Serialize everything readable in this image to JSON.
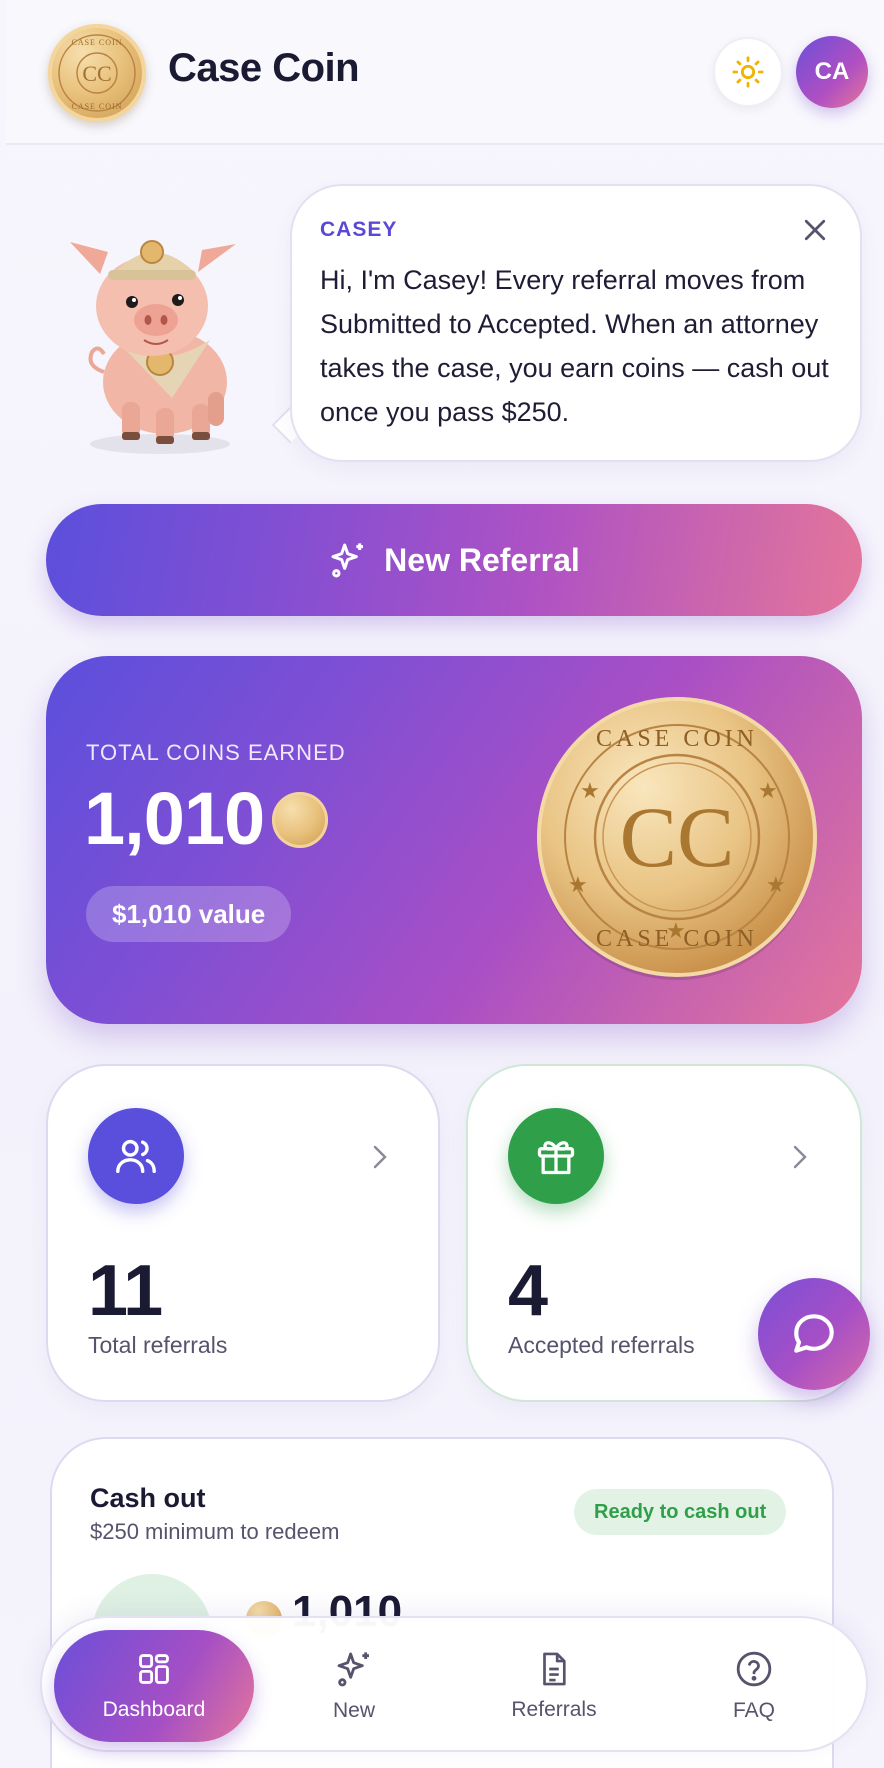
{
  "header": {
    "app_title": "Case Coin",
    "theme_icon": "sun-icon",
    "avatar_initials": "CA",
    "logo_text_top": "CASE COIN",
    "logo_text_bottom": "CASE COIN",
    "logo_monogram": "CC"
  },
  "mascot": {
    "name": "CASEY",
    "message": "Hi, I'm Casey! Every referral moves from Submitted to Accepted. When an attorney takes the case, you earn coins — cash out once you pass $250.",
    "close_icon": "close-icon"
  },
  "new_referral": {
    "label": "New Referral",
    "icon": "sparkles-icon"
  },
  "coins": {
    "label": "TOTAL COINS EARNED",
    "value": "1,010",
    "value_pill": "$1,010 value",
    "coin_text_top": "CASE COIN",
    "coin_text_bottom": "CASE COIN",
    "coin_monogram": "CC"
  },
  "stats": {
    "total": {
      "value": "11",
      "label": "Total referrals",
      "icon": "users-icon"
    },
    "accepted": {
      "value": "4",
      "label": "Accepted referrals",
      "icon": "gift-icon"
    }
  },
  "chat": {
    "icon": "chat-bubble-icon"
  },
  "cash_out": {
    "title": "Cash out",
    "subtitle": "$250 minimum to redeem",
    "badge": "Ready to cash out",
    "amount": "1,010"
  },
  "nav": {
    "items": [
      {
        "label": "Dashboard",
        "icon": "grid-icon"
      },
      {
        "label": "New",
        "icon": "sparkles-icon"
      },
      {
        "label": "Referrals",
        "icon": "document-icon"
      },
      {
        "label": "FAQ",
        "icon": "help-circle-icon"
      }
    ]
  },
  "colors": {
    "brand_indigo": "#5b4fdc",
    "brand_purple": "#ae52c4",
    "brand_pink": "#e4769a",
    "success_green": "#2f9f4a",
    "gold": "#e8c07a"
  }
}
